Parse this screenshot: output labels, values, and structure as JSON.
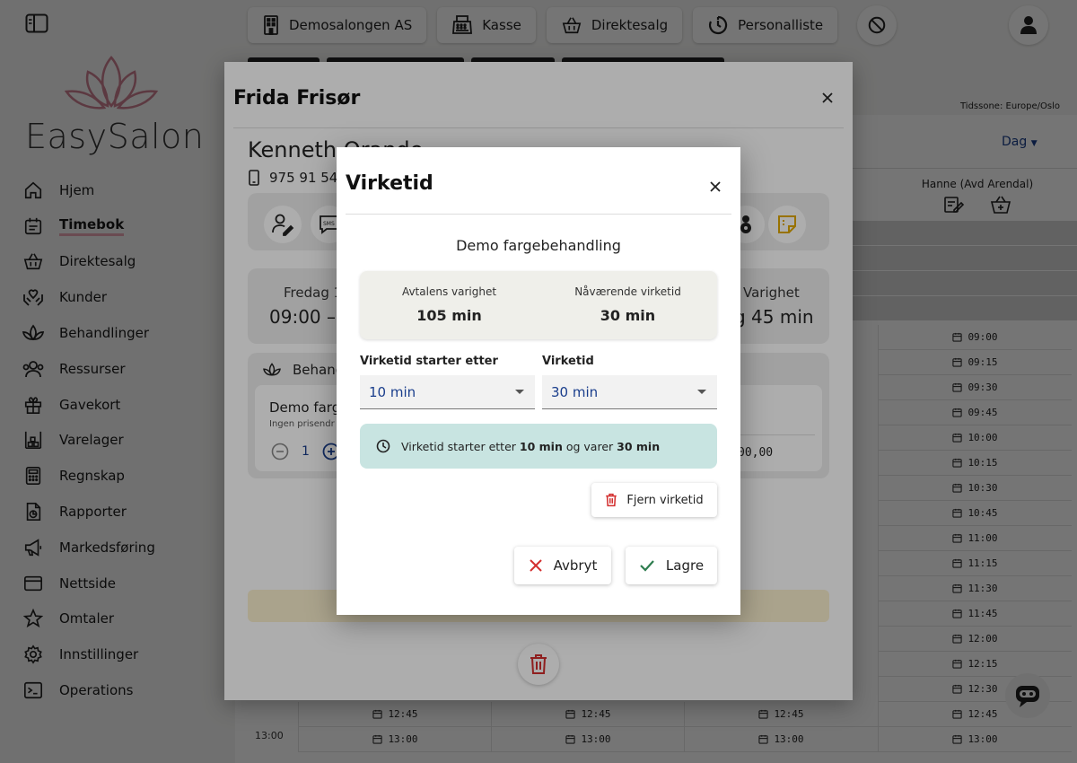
{
  "sidebar": {
    "logo_text": "EasySalon",
    "items": [
      {
        "label": "Hjem",
        "icon": "home-icon"
      },
      {
        "label": "Timebok",
        "icon": "calendar-icon"
      },
      {
        "label": "Direktesalg",
        "icon": "basket-icon"
      },
      {
        "label": "Kunder",
        "icon": "hands-heart-icon"
      },
      {
        "label": "Behandlinger",
        "icon": "lotus-icon"
      },
      {
        "label": "Ressurser",
        "icon": "users-icon"
      },
      {
        "label": "Gavekort",
        "icon": "gift-icon"
      },
      {
        "label": "Varelager",
        "icon": "warehouse-icon"
      },
      {
        "label": "Regnskap",
        "icon": "calculator-icon"
      },
      {
        "label": "Rapporter",
        "icon": "report-icon"
      },
      {
        "label": "Markedsføring",
        "icon": "megaphone-icon"
      },
      {
        "label": "Nettside",
        "icon": "browser-icon"
      },
      {
        "label": "Omtaler",
        "icon": "star-icon"
      },
      {
        "label": "Innstillinger",
        "icon": "gear-icon"
      },
      {
        "label": "Operations",
        "icon": "terminal-icon"
      }
    ],
    "active": "Timebok"
  },
  "topbar": {
    "salon": "Demosalongen AS",
    "kasse": "Kasse",
    "direktesalg": "Direktesalg",
    "personalliste": "Personalliste"
  },
  "calendar": {
    "timezone": "Tidssone: Europe/Oslo",
    "view": "Dag",
    "column_head": "Hanne (Avd Arendal)",
    "slots": [
      "09:00",
      "09:15",
      "09:30",
      "09:45",
      "10:00",
      "10:15",
      "10:30",
      "10:45",
      "11:00",
      "11:15",
      "11:30",
      "11:45",
      "12:00",
      "12:15",
      "12:30",
      "12:45",
      "13:00"
    ],
    "bottom_slots": [
      "12:45",
      "13:00"
    ],
    "time_label": "13:00"
  },
  "booking_panel": {
    "title": "Frida Frisør",
    "customer": "Kenneth Orande",
    "phone": "975 91 548",
    "date_label": "Fredag 12",
    "time": "09:00 –",
    "duration_label": "Varighet",
    "duration_value": "g 45 min",
    "treatments_label": "Behandl",
    "treatment_name": "Demo farge",
    "treatment_sub": "Ingen prisendr",
    "quantity": "1",
    "price": "00,00"
  },
  "dialog": {
    "title": "Virketid",
    "subtitle": "Demo fargebehandling",
    "summary": {
      "left_label": "Avtalens varighet",
      "left_value": "105 min",
      "right_label": "Nåværende virketid",
      "right_value": "30 min"
    },
    "start_field": {
      "label": "Virketid starter etter",
      "value": "10 min"
    },
    "duration_field": {
      "label": "Virketid",
      "value": "30 min"
    },
    "note": {
      "prefix": "Virketid starter etter",
      "start": "10 min",
      "middle": "og varer",
      "duration": "30 min"
    },
    "remove_label": "Fjern virketid",
    "cancel_label": "Avbryt",
    "save_label": "Lagre"
  },
  "colors": {
    "accent_blue": "#1a3e8c",
    "logo_pink": "#c97d8e",
    "note_bg": "#c8e4e1",
    "delete_red": "#d32f2f",
    "save_green": "#2e7d4f"
  }
}
